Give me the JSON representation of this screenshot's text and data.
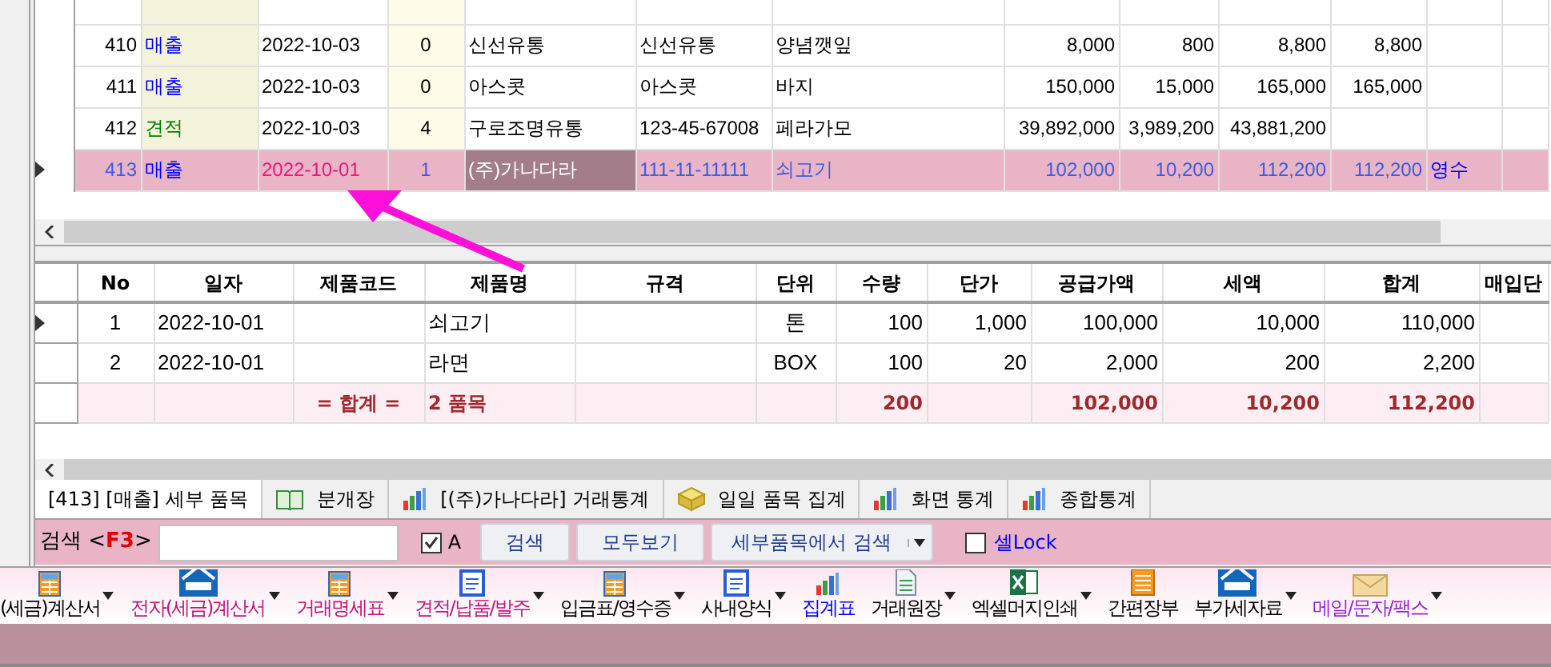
{
  "top_grid": {
    "rows": [
      {
        "no": "410",
        "type": {
          "label": "매출",
          "color": "#0000ff"
        },
        "date": "2022-10-03",
        "count": "0",
        "company": "신선유통",
        "bizno": "신선유통",
        "item": "양념깻잎",
        "supply": "8,000",
        "tax": "800",
        "total": "8,800",
        "paid": "8,800",
        "note": "",
        "selected": false
      },
      {
        "no": "411",
        "type": {
          "label": "매출",
          "color": "#0000ff"
        },
        "date": "2022-10-03",
        "count": "0",
        "company": "아스콧",
        "bizno": "아스콧",
        "item": "바지",
        "supply": "150,000",
        "tax": "15,000",
        "total": "165,000",
        "paid": "165,000",
        "note": "",
        "selected": false
      },
      {
        "no": "412",
        "type": {
          "label": "견적",
          "color": "#008000"
        },
        "date": "2022-10-03",
        "count": "4",
        "company": "구로조명유통",
        "bizno": "123-45-67008",
        "item": "페라가모",
        "supply": "39,892,000",
        "tax": "3,989,200",
        "total": "43,881,200",
        "paid": "",
        "note": "",
        "selected": false
      },
      {
        "no": "413",
        "type": {
          "label": "매출",
          "color": "#0000ff"
        },
        "date": "2022-10-01",
        "count": "1",
        "company": "(주)가나다라",
        "bizno": "111-11-11111",
        "item": "쇠고기",
        "supply": "102,000",
        "tax": "10,200",
        "total": "112,200",
        "paid": "112,200",
        "note": "영수",
        "selected": true
      }
    ]
  },
  "detail_grid": {
    "columns": [
      "No",
      "일자",
      "제품코드",
      "제품명",
      "규격",
      "단위",
      "수량",
      "단가",
      "공급가액",
      "세액",
      "합계",
      "매입단"
    ],
    "rows": [
      {
        "no": "1",
        "date": "2022-10-01",
        "code": "",
        "name": "쇠고기",
        "spec": "",
        "unit": "톤",
        "qty": "100",
        "price": "1,000",
        "supply": "100,000",
        "tax": "10,000",
        "total": "110,000",
        "selected": true
      },
      {
        "no": "2",
        "date": "2022-10-01",
        "code": "",
        "name": "라면",
        "spec": "",
        "unit": "BOX",
        "qty": "100",
        "price": "20",
        "supply": "2,000",
        "tax": "200",
        "total": "2,200",
        "selected": false
      }
    ],
    "total_row": {
      "label": "= 합계 =",
      "count": "2 품목",
      "qty": "200",
      "supply": "102,000",
      "tax": "10,200",
      "total": "112,200"
    }
  },
  "tabs": [
    {
      "label": "[413] [매출] 세부 품목",
      "kind": "plain",
      "selected": true
    },
    {
      "label": "분개장",
      "kind": "book",
      "selected": false
    },
    {
      "label": "[(주)가나다라] 거래통계",
      "kind": "chart",
      "selected": false
    },
    {
      "label": "일일 품목 집계",
      "kind": "box",
      "selected": false
    },
    {
      "label": "화면 통계",
      "kind": "chart",
      "selected": false
    },
    {
      "label": "종합통계",
      "kind": "chart",
      "selected": false
    }
  ],
  "search": {
    "label": "검색 <**F3**>",
    "a_checkbox": {
      "label": "A",
      "checked": true
    },
    "buttons": [
      "검색",
      "모두보기"
    ],
    "scope": "세부품목에서 검색",
    "lock_checkbox": {
      "label": "셀Lock",
      "checked": false
    }
  },
  "toolbar": [
    {
      "label": "(세금)계산서",
      "kind": "sheet",
      "color": "#000000",
      "dropdown": true
    },
    {
      "label": "전자(세금)계산서",
      "kind": "home",
      "color": "#c0157a",
      "dropdown": true
    },
    {
      "label": "거래명세표",
      "kind": "sheet",
      "color": "#c0157a",
      "dropdown": true
    },
    {
      "label": "견적/납품/발주",
      "kind": "note",
      "color": "#c0157a",
      "dropdown": true
    },
    {
      "label": "입금표/영수증",
      "kind": "sheet",
      "color": "#000000",
      "dropdown": true
    },
    {
      "label": "사내양식",
      "kind": "note",
      "color": "#000000",
      "dropdown": true
    },
    {
      "label": "집계표",
      "kind": "chart",
      "color": "#0000ff",
      "dropdown": false
    },
    {
      "label": "거래원장",
      "kind": "page",
      "color": "#000000",
      "dropdown": true
    },
    {
      "label": "엑셀머지인쇄",
      "kind": "excel",
      "color": "#000000",
      "dropdown": true
    },
    {
      "label": "간편장부",
      "kind": "ledger",
      "color": "#000000",
      "dropdown": false
    },
    {
      "label": "부가세자료",
      "kind": "home",
      "color": "#000000",
      "dropdown": true
    },
    {
      "label": "메일/문자/팩스",
      "kind": "mail",
      "color": "#9b1fd6",
      "dropdown": true
    }
  ]
}
